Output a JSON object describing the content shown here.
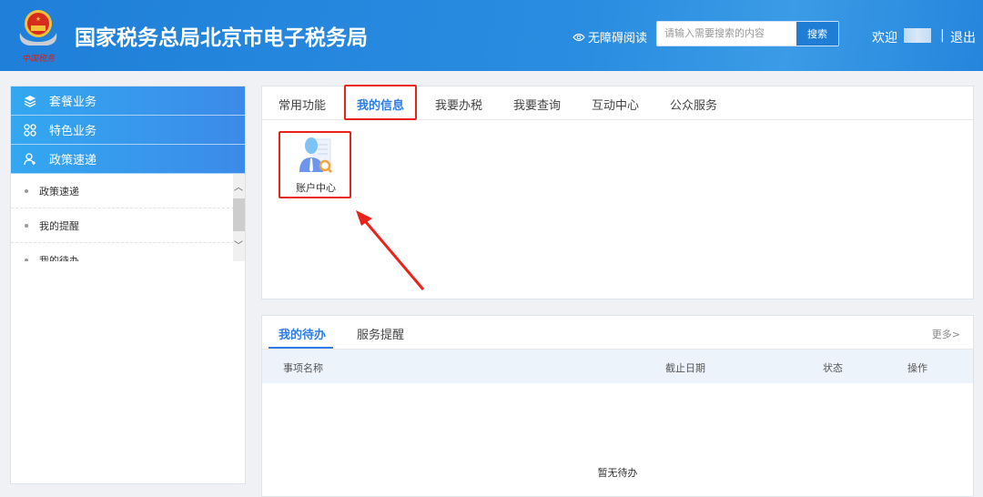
{
  "header": {
    "title": "国家税务总局北京市电子税务局",
    "logo_signature": "中国税务",
    "accessibility": "无障碍阅读",
    "search_placeholder": "请输入需要搜索的内容",
    "search_button": "搜索",
    "welcome": "欢迎",
    "separator": "|",
    "logout": "退出"
  },
  "sidebar": {
    "menus": [
      {
        "label": "套餐业务",
        "icon": "layers-icon"
      },
      {
        "label": "特色业务",
        "icon": "grid-icon"
      },
      {
        "label": "政策速递",
        "icon": "user-icon"
      }
    ],
    "sub_items": [
      "政策速递",
      "我的提醒",
      "我的待办"
    ]
  },
  "main": {
    "tabs": [
      "常用功能",
      "我的信息",
      "我要办税",
      "我要查询",
      "互动中心",
      "公众服务"
    ],
    "active_tab": "我的信息",
    "tiles": [
      {
        "label": "账户中心"
      }
    ]
  },
  "todo": {
    "tabs": [
      "我的待办",
      "服务提醒"
    ],
    "more": "更多>",
    "columns": [
      "事项名称",
      "截止日期",
      "状态",
      "操作"
    ],
    "empty": "暂无待办"
  },
  "colors": {
    "primary": "#2e7ce6",
    "highlight": "#e8231c",
    "header": "#1f7fd9"
  }
}
